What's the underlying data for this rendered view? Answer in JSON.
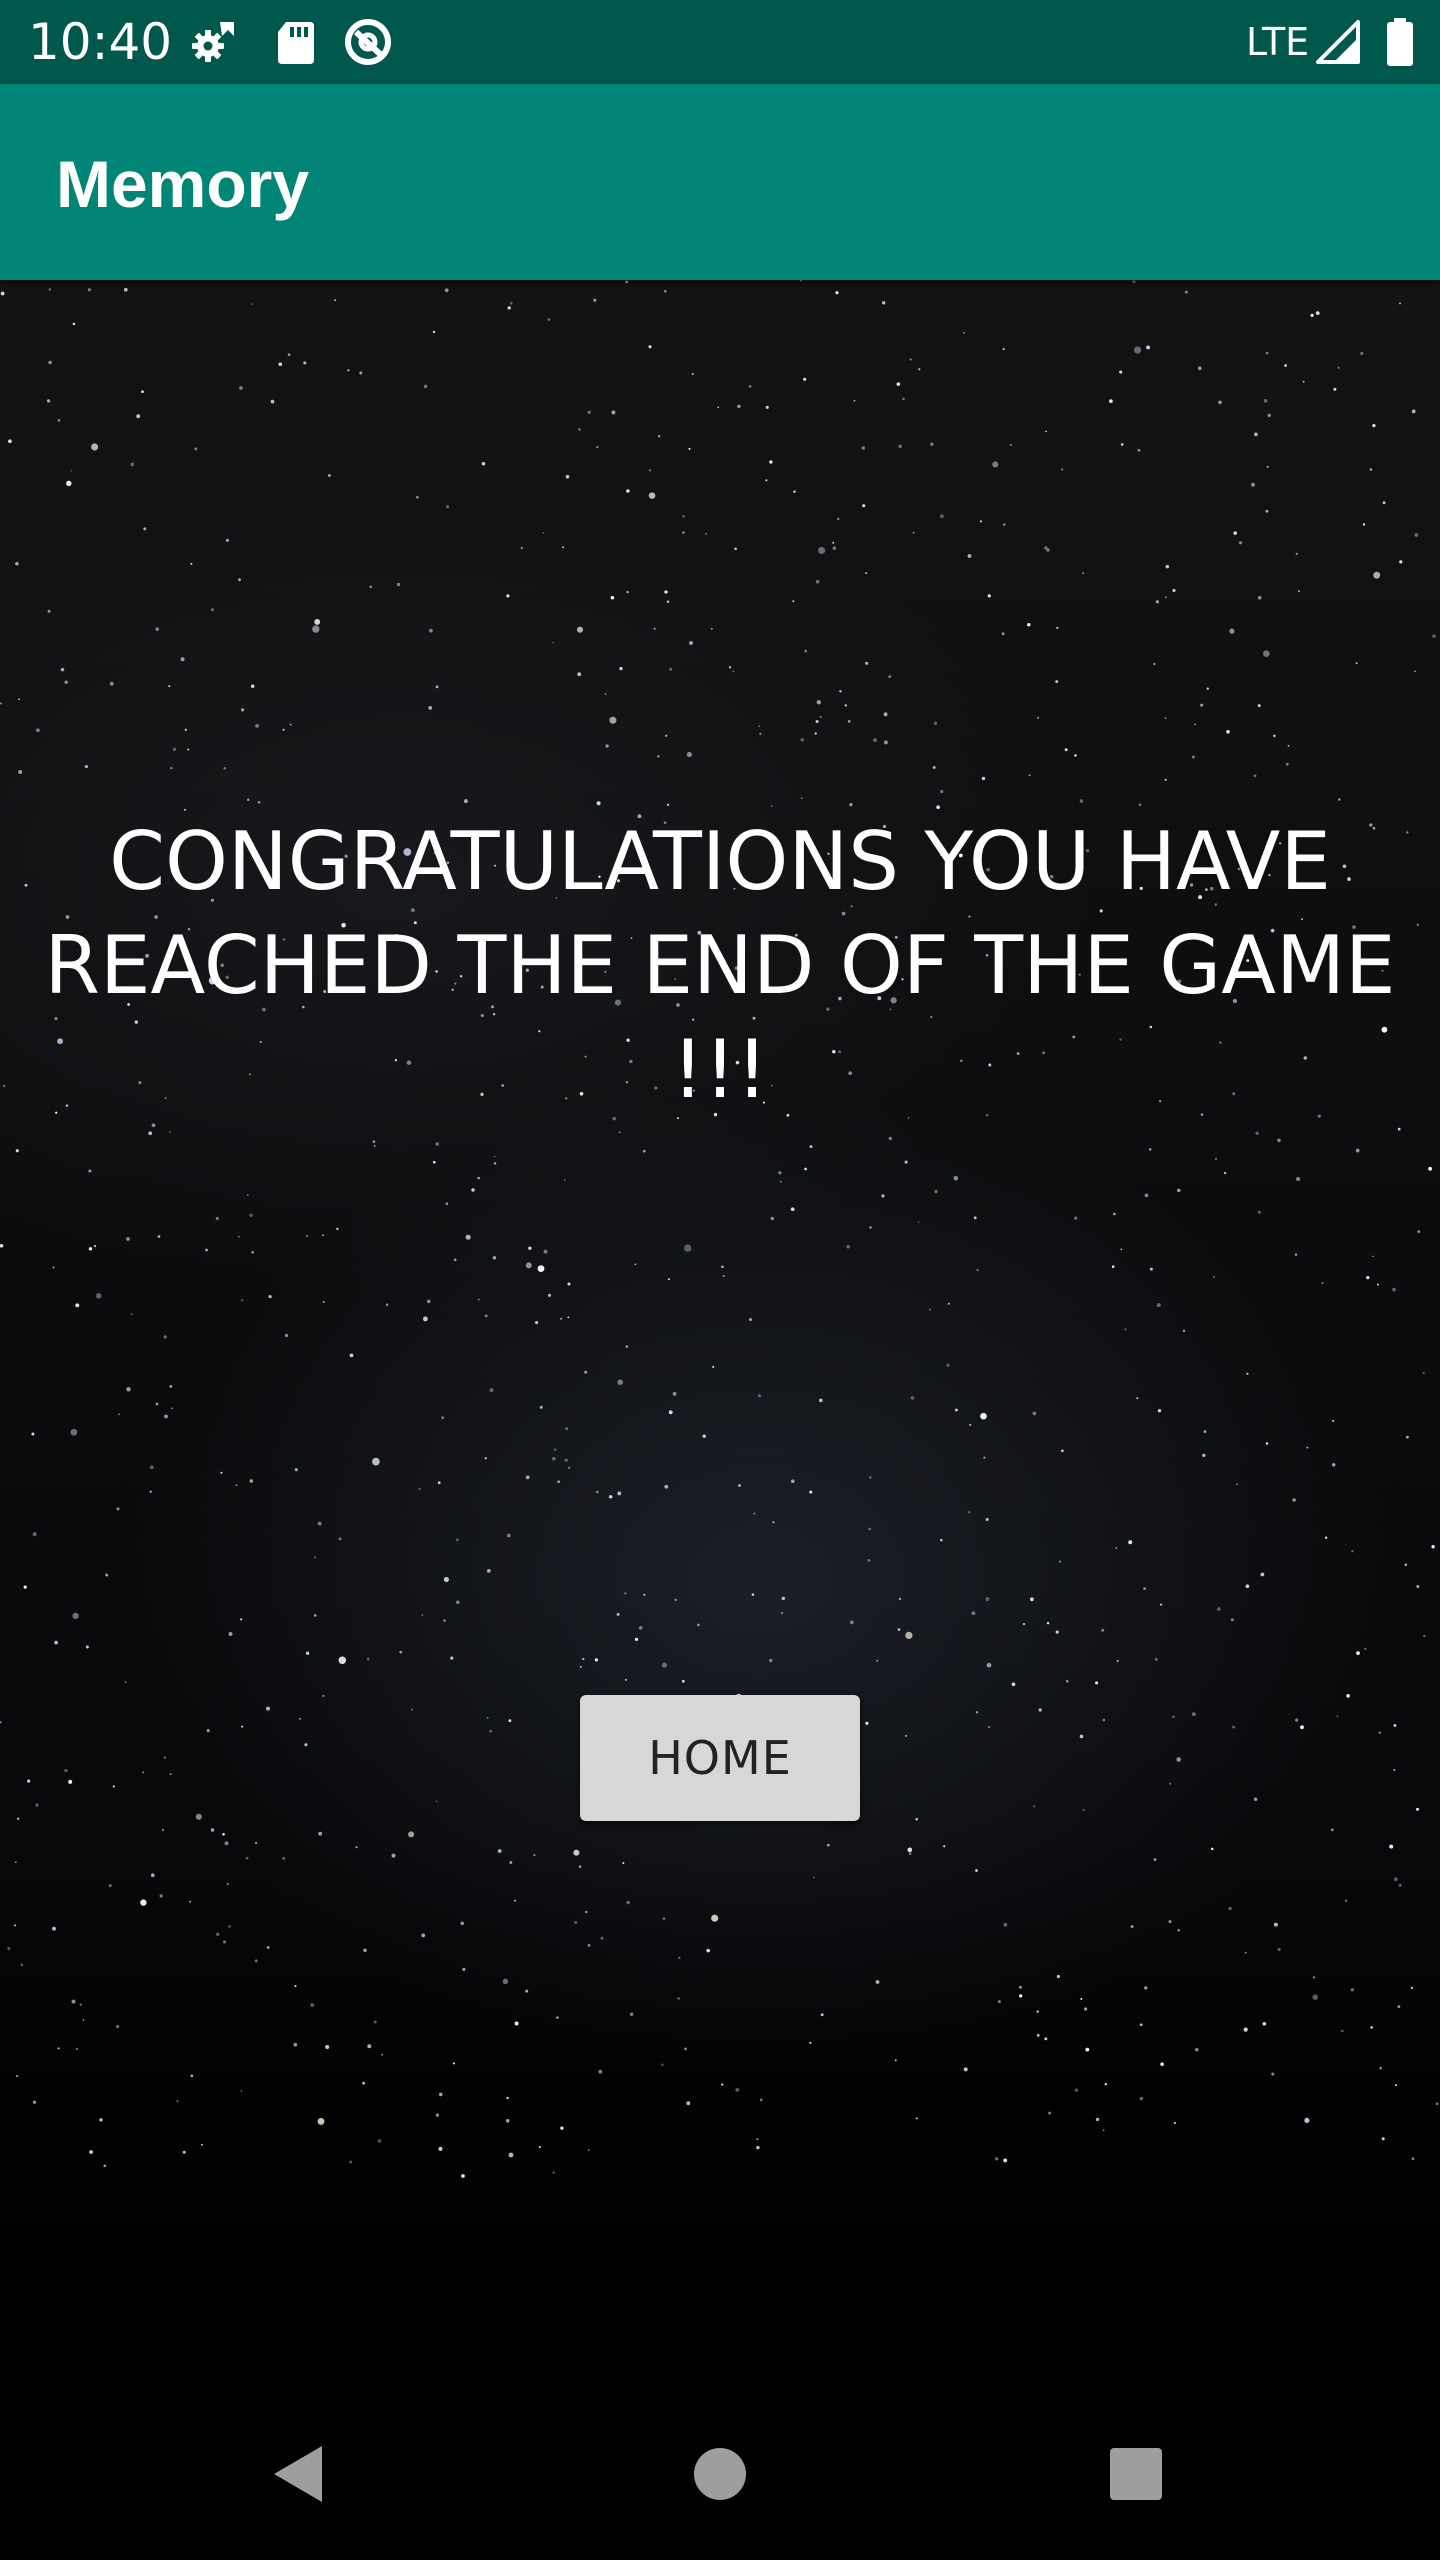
{
  "status_bar": {
    "time": "10:40",
    "network": "LTE",
    "icons": [
      "settings-sync-icon",
      "sd-card-icon",
      "data-saver-icon",
      "signal-icon",
      "battery-icon"
    ]
  },
  "app_bar": {
    "title": "Memory",
    "color": "#008577"
  },
  "main": {
    "message": "CONGRATULATIONS YOU HAVE REACHED THE END OF THE GAME !!!",
    "home_button_label": "HOME",
    "background": "starry-night-sky"
  },
  "nav_bar": {
    "buttons": [
      "back-icon",
      "home-icon",
      "recents-icon"
    ]
  },
  "colors": {
    "status_bar": "#00574b",
    "accent": "#008577",
    "button": "#d6d7d7"
  }
}
